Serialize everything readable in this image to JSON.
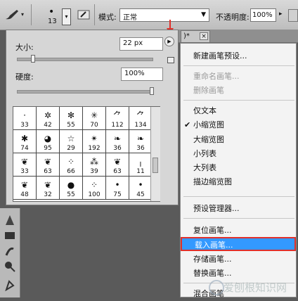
{
  "options_bar": {
    "size_value": "13",
    "mode_label": "模式:",
    "mode_value": "正常",
    "opacity_label": "不透明度:",
    "opacity_value": "100%"
  },
  "doc_tab": {
    "close": "×"
  },
  "brush_panel": {
    "size_label": "大小:",
    "size_value": "22 px",
    "size_slider_fraction": 0.12,
    "hardness_label": "硬度:",
    "hardness_value": "100%",
    "hardness_slider_fraction": 1.0,
    "brushes": [
      {
        "n": "33",
        "g": "·"
      },
      {
        "n": "42",
        "g": "✲"
      },
      {
        "n": "55",
        "g": "✻"
      },
      {
        "n": "70",
        "g": "✳"
      },
      {
        "n": "112",
        "g": "⺈"
      },
      {
        "n": "134",
        "g": "⺈"
      },
      {
        "n": "74",
        "g": "✱"
      },
      {
        "n": "95",
        "g": "◕"
      },
      {
        "n": "29",
        "g": "☆"
      },
      {
        "n": "192",
        "g": "✴"
      },
      {
        "n": "36",
        "g": "❧"
      },
      {
        "n": "36",
        "g": "❧"
      },
      {
        "n": "33",
        "g": "❦"
      },
      {
        "n": "63",
        "g": "❦"
      },
      {
        "n": "66",
        "g": "⁘"
      },
      {
        "n": "39",
        "g": "⁂"
      },
      {
        "n": "63",
        "g": "❦"
      },
      {
        "n": "11",
        "g": "╷"
      },
      {
        "n": "48",
        "g": "❦"
      },
      {
        "n": "32",
        "g": "❦"
      },
      {
        "n": "55",
        "g": "●"
      },
      {
        "n": "100",
        "g": "⁘"
      },
      {
        "n": "75",
        "g": "•"
      },
      {
        "n": "45",
        "g": "•"
      }
    ]
  },
  "menu": {
    "items": [
      {
        "label": "新建画笔预设...",
        "state": "enabled"
      },
      {
        "label": "重命名画笔...",
        "state": "disabled"
      },
      {
        "label": "删除画笔",
        "state": "disabled"
      },
      {
        "label": "仅文本",
        "state": "enabled"
      },
      {
        "label": "小缩览图",
        "state": "checked"
      },
      {
        "label": "大缩览图",
        "state": "enabled"
      },
      {
        "label": "小列表",
        "state": "enabled"
      },
      {
        "label": "大列表",
        "state": "enabled"
      },
      {
        "label": "描边缩览图",
        "state": "enabled"
      },
      {
        "label": "预设管理器...",
        "state": "enabled"
      },
      {
        "label": "复位画笔...",
        "state": "enabled"
      },
      {
        "label": "载入画笔...",
        "state": "highlighted"
      },
      {
        "label": "存储画笔...",
        "state": "enabled"
      },
      {
        "label": "替换画笔...",
        "state": "enabled"
      },
      {
        "label": "混合画笔",
        "state": "enabled"
      }
    ],
    "check_mark": "✔",
    "highlight_color": "#3399ff",
    "highlight_border_color": "#e0302a"
  },
  "watermark": {
    "text": "爱刨根知识网"
  }
}
